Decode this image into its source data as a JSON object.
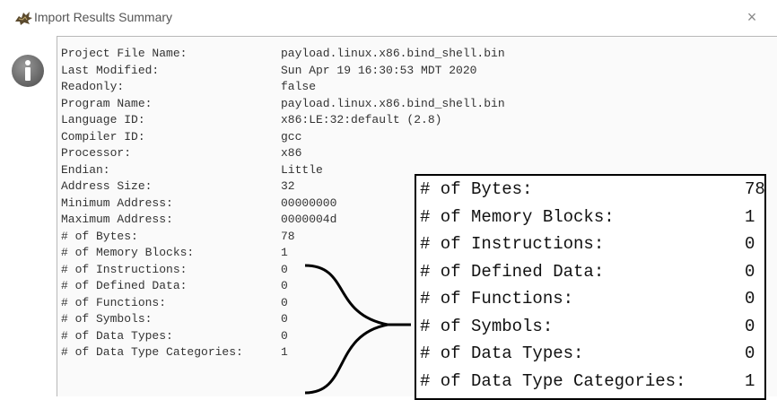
{
  "window": {
    "title": "Import Results Summary",
    "close_glyph": "×",
    "app_icon": "dragon-icon",
    "info_icon": "info-icon"
  },
  "summary": [
    {
      "label": "Project File Name:",
      "value": "payload.linux.x86.bind_shell.bin"
    },
    {
      "label": "Last Modified:",
      "value": "Sun Apr 19 16:30:53 MDT 2020"
    },
    {
      "label": "Readonly:",
      "value": "false"
    },
    {
      "label": "Program Name:",
      "value": "payload.linux.x86.bind_shell.bin"
    },
    {
      "label": "Language ID:",
      "value": "x86:LE:32:default (2.8)"
    },
    {
      "label": "Compiler ID:",
      "value": "gcc"
    },
    {
      "label": "Processor:",
      "value": "x86"
    },
    {
      "label": "Endian:",
      "value": "Little"
    },
    {
      "label": "Address Size:",
      "value": "32"
    },
    {
      "label": "Minimum Address:",
      "value": "00000000"
    },
    {
      "label": "Maximum Address:",
      "value": "0000004d"
    },
    {
      "label": "# of Bytes:",
      "value": "78"
    },
    {
      "label": "# of Memory Blocks:",
      "value": "1"
    },
    {
      "label": "# of Instructions:",
      "value": "0"
    },
    {
      "label": "# of Defined Data:",
      "value": "0"
    },
    {
      "label": "# of Functions:",
      "value": "0"
    },
    {
      "label": "# of Symbols:",
      "value": "0"
    },
    {
      "label": "# of Data Types:",
      "value": "0"
    },
    {
      "label": "# of Data Type Categories:",
      "value": "1"
    }
  ],
  "zoom": [
    {
      "label": "# of Bytes:",
      "value": "78"
    },
    {
      "label": "# of Memory Blocks:",
      "value": "1"
    },
    {
      "label": "# of Instructions:",
      "value": "0"
    },
    {
      "label": "# of Defined Data:",
      "value": "0"
    },
    {
      "label": "# of Functions:",
      "value": "0"
    },
    {
      "label": "# of Symbols:",
      "value": "0"
    },
    {
      "label": "# of Data Types:",
      "value": "0"
    },
    {
      "label": "# of Data Type Categories:",
      "value": "1"
    }
  ]
}
